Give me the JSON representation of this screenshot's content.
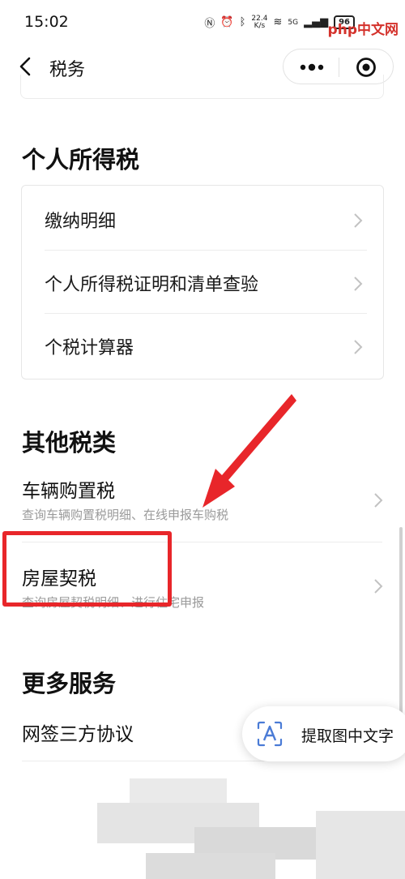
{
  "status_bar": {
    "time": "15:02",
    "net_speed_value": "22.4",
    "net_speed_unit": "K/s",
    "network": "5G",
    "battery": "96",
    "watermark_text": "php中文网"
  },
  "nav": {
    "title": "税务"
  },
  "sections": {
    "personal_income_tax": {
      "title": "个人所得税",
      "items": [
        {
          "label": "缴纳明细"
        },
        {
          "label": "个人所得税证明和清单查验"
        },
        {
          "label": "个税计算器"
        }
      ]
    },
    "other_taxes": {
      "title": "其他税类",
      "items": [
        {
          "title": "车辆购置税",
          "subtitle": "查询车辆购置税明细、在线申报车购税"
        },
        {
          "title": "房屋契税",
          "subtitle": "查询房屋契税明细、进行住宅申报"
        }
      ]
    },
    "more_services": {
      "title": "更多服务",
      "items": [
        {
          "label": "网签三方协议"
        }
      ]
    }
  },
  "ocr_button": {
    "label": "提取图中文字"
  },
  "colors": {
    "highlight": "#e8262a",
    "text_primary": "#111111",
    "text_secondary": "#9a9a9a"
  }
}
